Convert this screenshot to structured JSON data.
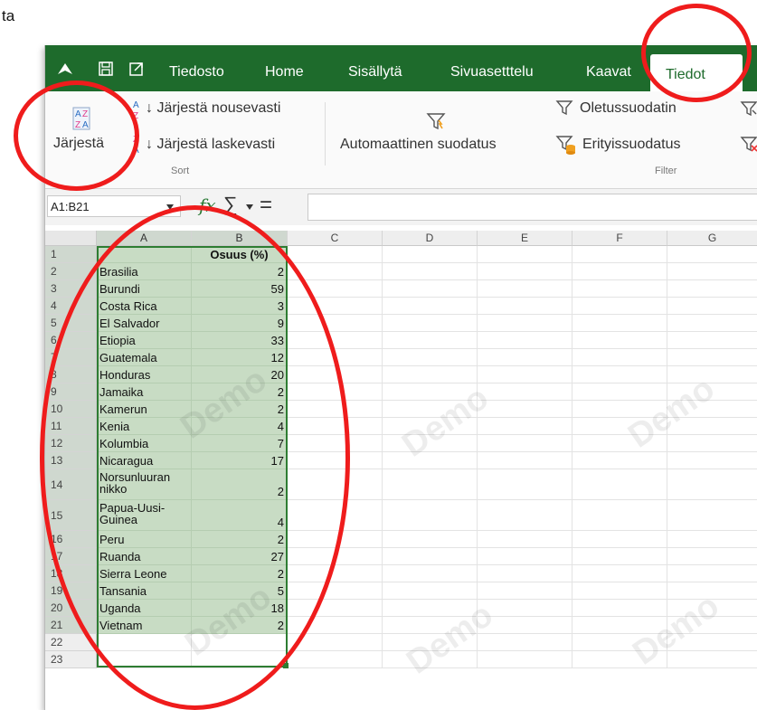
{
  "page_label": "ta",
  "menu": {
    "items": [
      "Tiedosto",
      "Home",
      "Sisällytä",
      "Sivuasetttelu",
      "Kaavat"
    ],
    "active": "Tiedot"
  },
  "ribbon": {
    "sort_button": "Järjestä",
    "sort_asc": "Järjestä nousevasti",
    "sort_desc": "Järjestä laskevasti",
    "sort_group": "Sort",
    "auto_filter": "Automaattinen suodatus",
    "default_filter": "Oletussuodatin",
    "special_filter": "Erityissuodatus",
    "filter_group": "Filter"
  },
  "formula_bar": {
    "name_box": "A1:B21",
    "fx": "fx",
    "sigma": "∑",
    "equals": "=",
    "formula": ""
  },
  "grid": {
    "columns": [
      "A",
      "B",
      "C",
      "D",
      "E",
      "F",
      "G"
    ],
    "header_b": "Osuus (%)",
    "rows": [
      {
        "n": "1",
        "a": "",
        "b": ""
      },
      {
        "n": "2",
        "a": "Brasilia",
        "b": "2"
      },
      {
        "n": "3",
        "a": "Burundi",
        "b": "59"
      },
      {
        "n": "4",
        "a": "Costa Rica",
        "b": "3"
      },
      {
        "n": "5",
        "a": "El Salvador",
        "b": "9"
      },
      {
        "n": "6",
        "a": "Etiopia",
        "b": "33"
      },
      {
        "n": "7",
        "a": "Guatemala",
        "b": "12"
      },
      {
        "n": "8",
        "a": "Honduras",
        "b": "20"
      },
      {
        "n": "9",
        "a": "Jamaika",
        "b": "2"
      },
      {
        "n": "10",
        "a": "Kamerun",
        "b": "2"
      },
      {
        "n": "11",
        "a": "Kenia",
        "b": "4"
      },
      {
        "n": "12",
        "a": "Kolumbia",
        "b": "7"
      },
      {
        "n": "13",
        "a": "Nicaragua",
        "b": "17"
      },
      {
        "n": "14",
        "a": "Norsunluuran nikko",
        "b": "2"
      },
      {
        "n": "15",
        "a": "Papua-Uusi-Guinea",
        "b": "4"
      },
      {
        "n": "16",
        "a": "Peru",
        "b": "2"
      },
      {
        "n": "17",
        "a": "Ruanda",
        "b": "27"
      },
      {
        "n": "18",
        "a": "Sierra Leone",
        "b": "2"
      },
      {
        "n": "19",
        "a": "Tansania",
        "b": "5"
      },
      {
        "n": "20",
        "a": "Uganda",
        "b": "18"
      },
      {
        "n": "21",
        "a": "Vietnam",
        "b": "2"
      },
      {
        "n": "22",
        "a": "",
        "b": ""
      },
      {
        "n": "23",
        "a": "",
        "b": ""
      }
    ],
    "watermark": "Demo"
  },
  "colors": {
    "accent": "#1e6b2c",
    "selection": "#c8dcc4",
    "annotation": "#ef1c1c"
  }
}
